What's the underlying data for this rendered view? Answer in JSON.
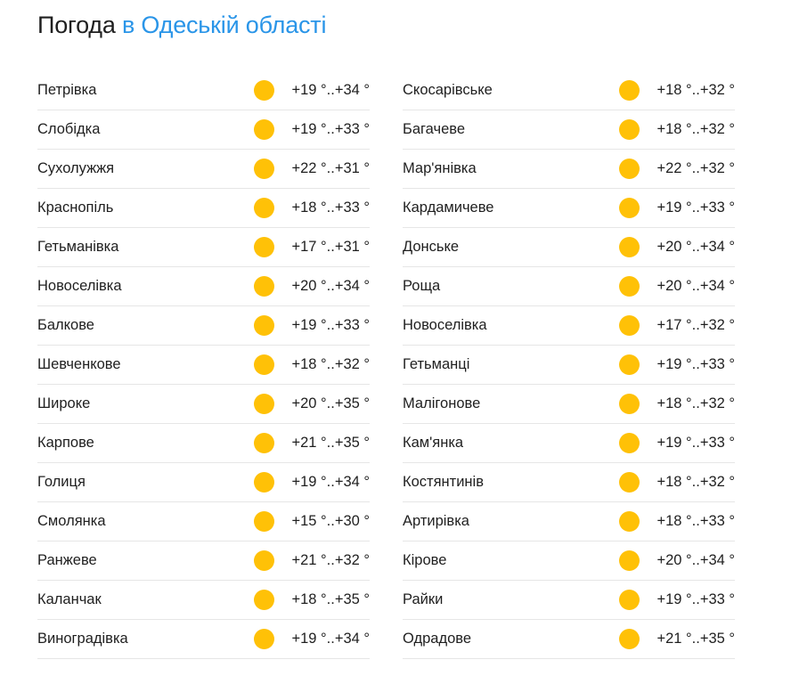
{
  "header": {
    "title_prefix": "Погода",
    "title_region": "в Одеській області"
  },
  "colors": {
    "accent": "#2a95e8",
    "sun": "#ffc107",
    "divider": "#e6e6e6"
  },
  "weather_icon": "sun-icon",
  "left_column": [
    {
      "city": "Петрівка",
      "temp": "+19 °..+34 °"
    },
    {
      "city": "Слобідка",
      "temp": "+19 °..+33 °"
    },
    {
      "city": "Сухолужжя",
      "temp": "+22 °..+31 °"
    },
    {
      "city": "Краснопіль",
      "temp": "+18 °..+33 °"
    },
    {
      "city": "Гетьманівка",
      "temp": "+17 °..+31 °"
    },
    {
      "city": "Новоселівка",
      "temp": "+20 °..+34 °"
    },
    {
      "city": "Балкове",
      "temp": "+19 °..+33 °"
    },
    {
      "city": "Шевченкове",
      "temp": "+18 °..+32 °"
    },
    {
      "city": "Широке",
      "temp": "+20 °..+35 °"
    },
    {
      "city": "Карпове",
      "temp": "+21 °..+35 °"
    },
    {
      "city": "Голиця",
      "temp": "+19 °..+34 °"
    },
    {
      "city": "Смолянка",
      "temp": "+15 °..+30 °"
    },
    {
      "city": "Ранжеве",
      "temp": "+21 °..+32 °"
    },
    {
      "city": "Каланчак",
      "temp": "+18 °..+35 °"
    },
    {
      "city": "Виноградівка",
      "temp": "+19 °..+34 °"
    }
  ],
  "right_column": [
    {
      "city": "Скосарівське",
      "temp": "+18 °..+32 °"
    },
    {
      "city": "Багачеве",
      "temp": "+18 °..+32 °"
    },
    {
      "city": "Мар'янівка",
      "temp": "+22 °..+32 °"
    },
    {
      "city": "Кардамичеве",
      "temp": "+19 °..+33 °"
    },
    {
      "city": "Донське",
      "temp": "+20 °..+34 °"
    },
    {
      "city": "Роща",
      "temp": "+20 °..+34 °"
    },
    {
      "city": "Новоселівка",
      "temp": "+17 °..+32 °"
    },
    {
      "city": "Гетьманці",
      "temp": "+19 °..+33 °"
    },
    {
      "city": "Малігонове",
      "temp": "+18 °..+32 °"
    },
    {
      "city": "Кам'янка",
      "temp": "+19 °..+33 °"
    },
    {
      "city": "Костянтинів",
      "temp": "+18 °..+32 °"
    },
    {
      "city": "Артирівка",
      "temp": "+18 °..+33 °"
    },
    {
      "city": "Кірове",
      "temp": "+20 °..+34 °"
    },
    {
      "city": "Райки",
      "temp": "+19 °..+33 °"
    },
    {
      "city": "Одрадове",
      "temp": "+21 °..+35 °"
    }
  ]
}
